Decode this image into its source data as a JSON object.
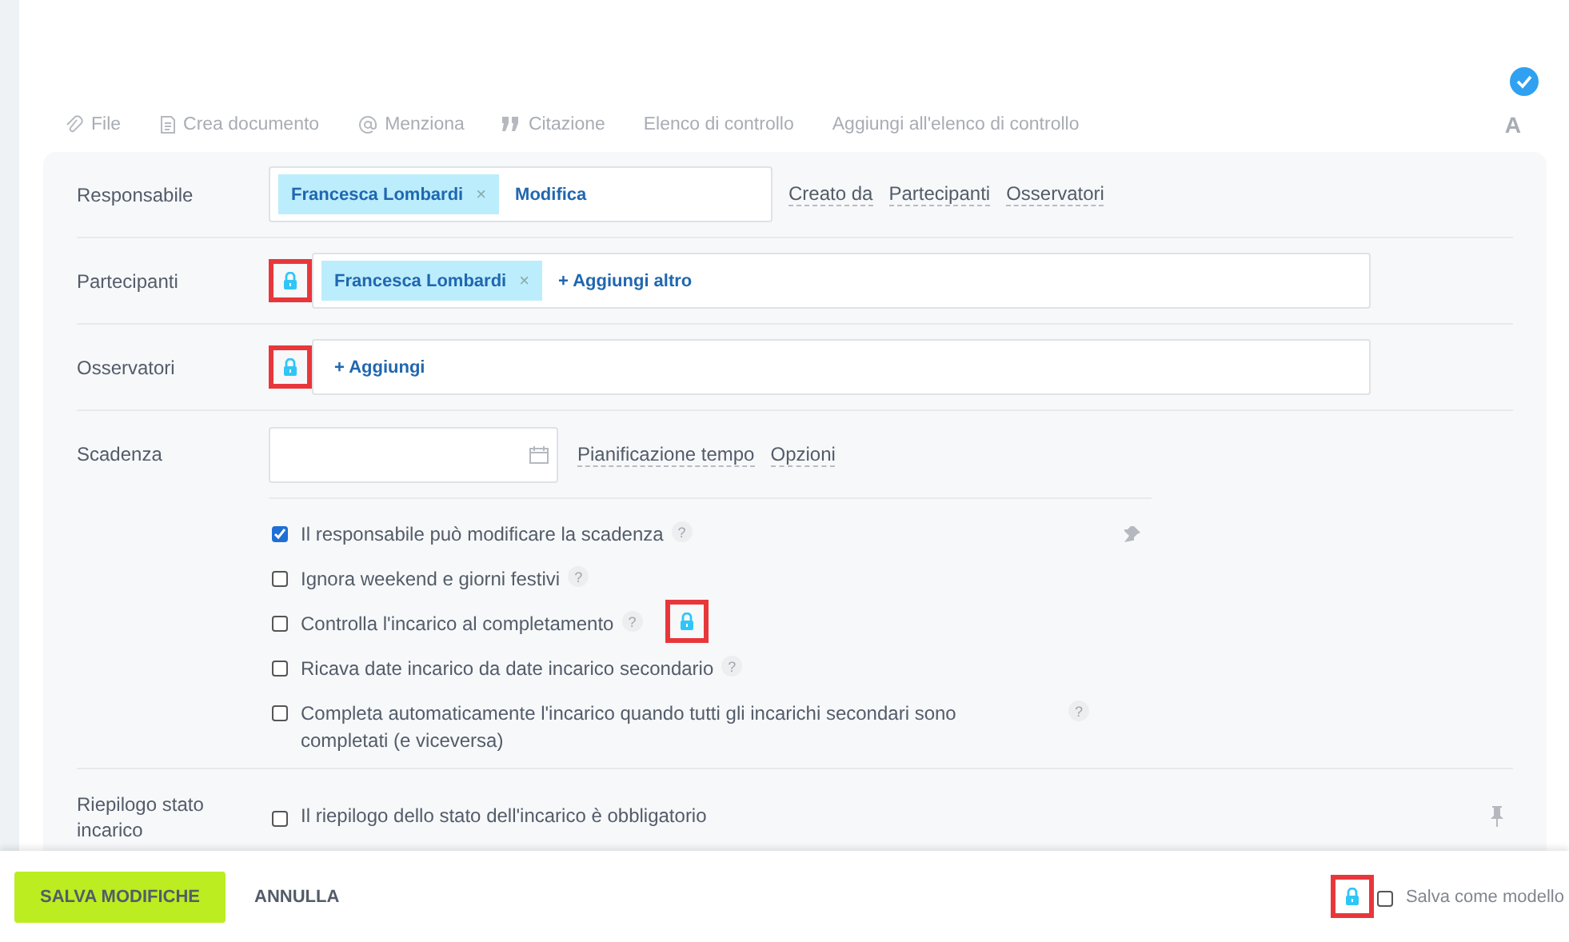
{
  "toolbar": [
    {
      "kind": "clip",
      "label": "File"
    },
    {
      "kind": "doc",
      "label": "Crea documento"
    },
    {
      "kind": "at",
      "label": "Menziona"
    },
    {
      "kind": "quote",
      "label": "Citazione"
    },
    {
      "kind": "none",
      "label": "Elenco di controllo"
    },
    {
      "kind": "none",
      "label": "Aggiungi all'elenco di controllo"
    }
  ],
  "format_button": "A",
  "responsible": {
    "label": "Responsabile",
    "person": "Francesca Lombardi",
    "action": "Modifica",
    "links": [
      "Creato da",
      "Partecipanti",
      "Osservatori"
    ]
  },
  "participants": {
    "label": "Partecipanti",
    "locked": true,
    "person": "Francesca Lombardi",
    "action": "+ Aggiungi altro"
  },
  "observers": {
    "label": "Osservatori",
    "locked": true,
    "action": "+ Aggiungi"
  },
  "deadline": {
    "label": "Scadenza",
    "links": [
      "Pianificazione tempo",
      "Opzioni"
    ]
  },
  "options": [
    {
      "label": "Il responsabile può modificare la scadenza",
      "checked": true,
      "locked": false
    },
    {
      "label": "Ignora weekend e giorni festivi",
      "checked": false,
      "locked": false
    },
    {
      "label": "Controlla l'incarico al completamento",
      "checked": false,
      "locked": true
    },
    {
      "label": "Ricava date incarico da date incarico secondario",
      "checked": false,
      "locked": false
    },
    {
      "label": "Completa automaticamente l'incarico quando tutti gli incarichi secondari sono completati (e viceversa)",
      "checked": false,
      "locked": false
    }
  ],
  "help_mark": "?",
  "remove_mark": "×",
  "summary": {
    "label": "Riepilogo stato incarico",
    "option": "Il riepilogo dello stato dell'incarico è obbligatorio",
    "checked": false
  },
  "footer": {
    "save": "SALVA MODIFICHE",
    "cancel": "ANNULLA",
    "locked": true,
    "template": "Salva come modello",
    "template_checked": false
  }
}
